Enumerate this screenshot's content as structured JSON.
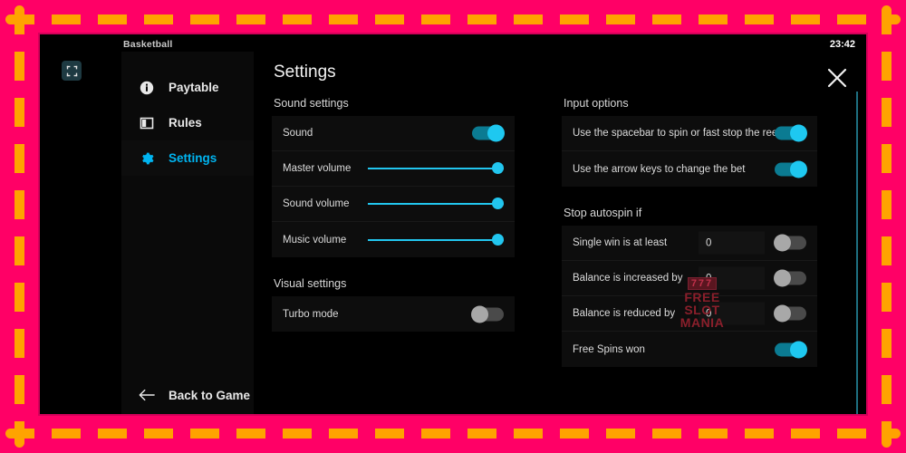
{
  "frame": {
    "border_color": "#ff0066",
    "dash_color": "#ffa300"
  },
  "window": {
    "game_title": "Basketball",
    "clock": "23:42",
    "fullscreen_icon": "fullscreen-collapse-icon",
    "close_icon": "close-icon"
  },
  "sidebar": {
    "items": [
      {
        "label": "Paytable",
        "icon": "info-icon",
        "active": false
      },
      {
        "label": "Rules",
        "icon": "book-icon",
        "active": false
      },
      {
        "label": "Settings",
        "icon": "gear-icon",
        "active": true
      }
    ],
    "back": {
      "label": "Back to Game",
      "icon": "arrow-left-icon"
    }
  },
  "settings": {
    "title": "Settings",
    "sections": {
      "sound": {
        "heading": "Sound settings",
        "rows": [
          {
            "label": "Sound",
            "control": "toggle",
            "state": "on"
          },
          {
            "label": "Master volume",
            "control": "slider",
            "value": 100
          },
          {
            "label": "Sound volume",
            "control": "slider",
            "value": 100
          },
          {
            "label": "Music volume",
            "control": "slider",
            "value": 100
          }
        ]
      },
      "visual": {
        "heading": "Visual settings",
        "rows": [
          {
            "label": "Turbo mode",
            "control": "toggle",
            "state": "off"
          }
        ]
      },
      "input": {
        "heading": "Input options",
        "rows": [
          {
            "label": "Use the spacebar to spin or fast stop the reels",
            "control": "toggle",
            "state": "on"
          },
          {
            "label": "Use the arrow keys to change the bet",
            "control": "toggle",
            "state": "on"
          }
        ]
      },
      "autospin": {
        "heading": "Stop autospin if",
        "rows": [
          {
            "label": "Single win is at least",
            "control": "input+toggle",
            "value": "0",
            "state": "off"
          },
          {
            "label": "Balance is increased by",
            "control": "input+toggle",
            "value": "0",
            "state": "off"
          },
          {
            "label": "Balance is reduced by",
            "control": "input+toggle",
            "value": "0",
            "state": "off"
          },
          {
            "label": "Free Spins won",
            "control": "toggle",
            "state": "on"
          }
        ]
      }
    }
  },
  "watermark": {
    "reels": "777",
    "line1": "FREE",
    "line2": "SLOT",
    "line3": "MANIA"
  },
  "colors": {
    "accent_cyan": "#1ec8f0",
    "toggle_on": "#0b7b92",
    "toggle_off": "#4a4a4a",
    "slider": "#22c6ef",
    "panel_bg": "#0d0d0d"
  }
}
